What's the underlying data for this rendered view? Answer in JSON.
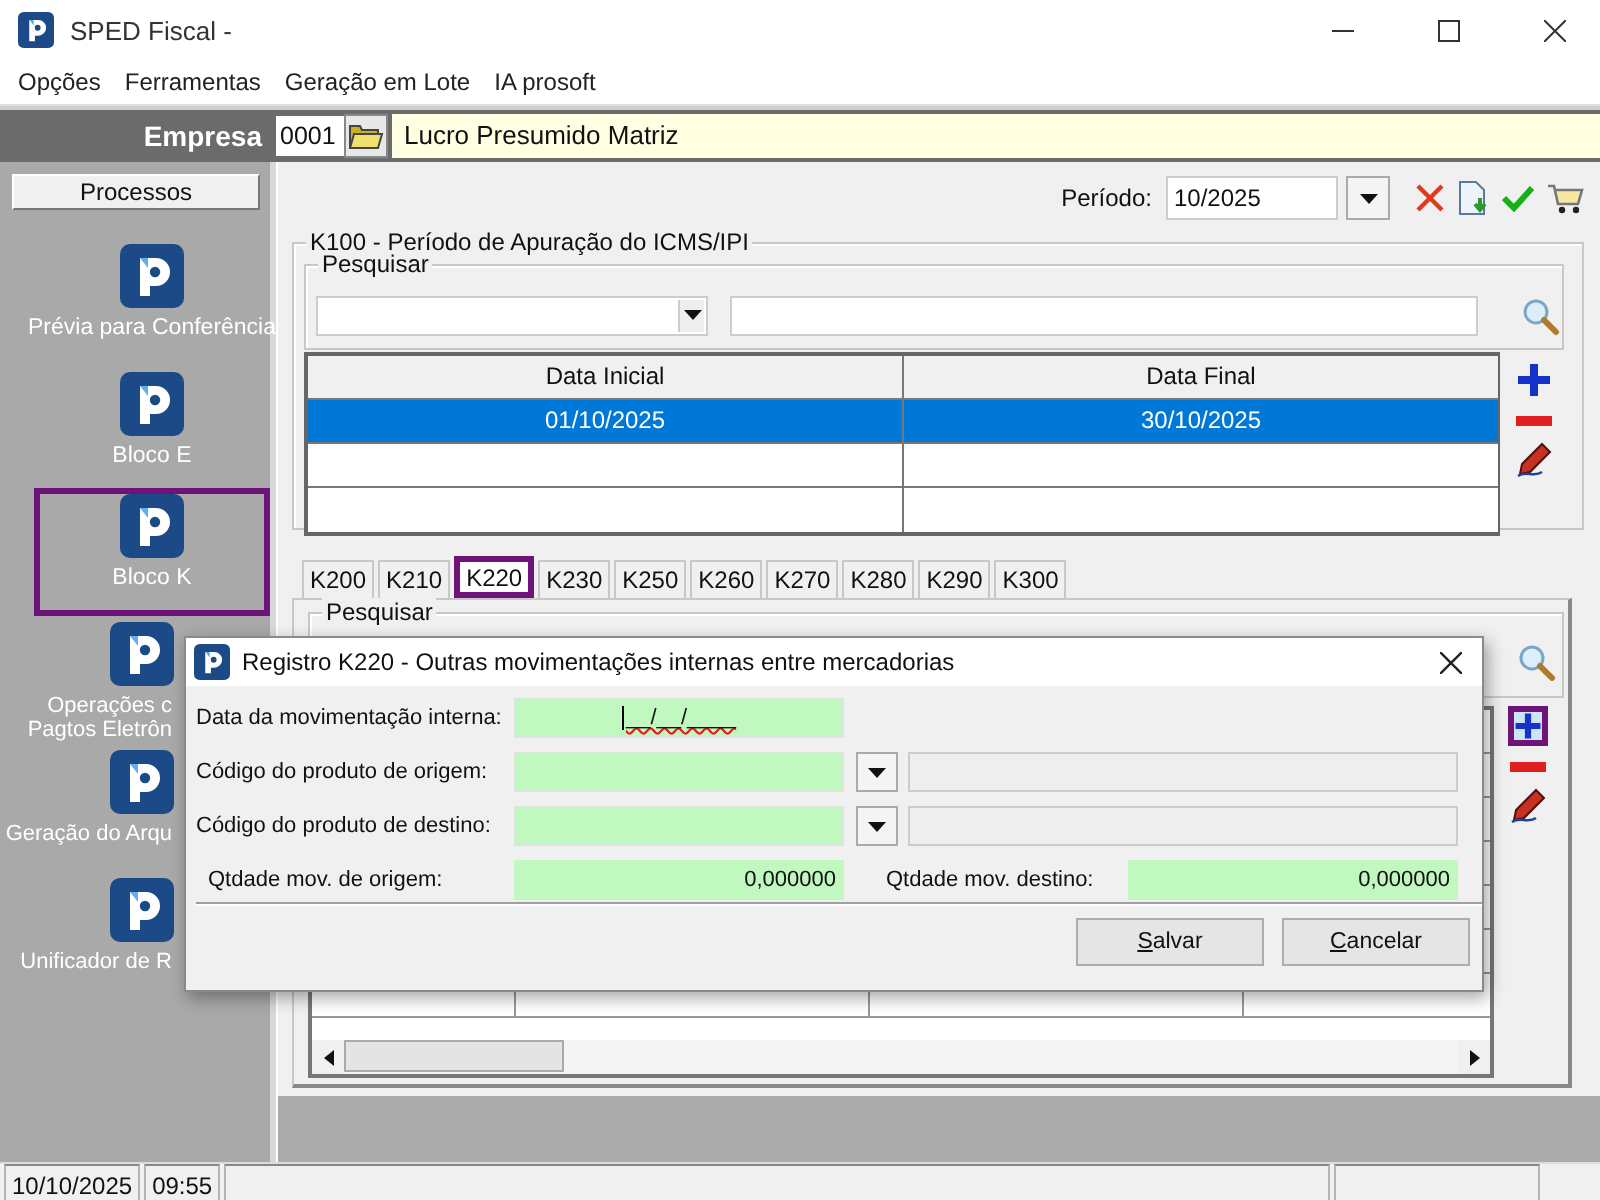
{
  "window": {
    "title": "SPED Fiscal -"
  },
  "menu": [
    "Opções",
    "Ferramentas",
    "Geração em Lote",
    "IA prosoft"
  ],
  "empresa": {
    "label": "Empresa",
    "code": "0001",
    "name": "Lucro Presumido Matriz"
  },
  "sidebar": {
    "header": "Processos",
    "items": [
      {
        "lines": [
          "Prévia para Conferência"
        ],
        "highlighted": false,
        "clipped": false
      },
      {
        "lines": [
          "Bloco E"
        ],
        "highlighted": false,
        "clipped": false
      },
      {
        "lines": [
          "Bloco K"
        ],
        "highlighted": true,
        "clipped": false
      },
      {
        "lines": [
          "Operações c",
          "Pagtos Eletrôn"
        ],
        "highlighted": false,
        "clipped": true
      },
      {
        "lines": [
          "Geração do Arqu"
        ],
        "highlighted": false,
        "clipped": true
      },
      {
        "lines": [
          "Unificador de R"
        ],
        "highlighted": false,
        "clipped": true
      }
    ]
  },
  "periodo": {
    "label": "Período:",
    "value": "10/2025"
  },
  "k100": {
    "title": "K100 - Período de Apuração do ICMS/IPI",
    "search_label": "Pesquisar",
    "columns": [
      "Data Inicial",
      "Data Final"
    ],
    "rows": [
      {
        "cells": [
          "01/10/2025",
          "30/10/2025"
        ],
        "selected": true
      }
    ]
  },
  "tabs": [
    {
      "label": "K200",
      "selected": false,
      "highlighted": false
    },
    {
      "label": "K210",
      "selected": false,
      "highlighted": false
    },
    {
      "label": "K220",
      "selected": true,
      "highlighted": true
    },
    {
      "label": "K230",
      "selected": false,
      "highlighted": false
    },
    {
      "label": "K250",
      "selected": false,
      "highlighted": false
    },
    {
      "label": "K260",
      "selected": false,
      "highlighted": false
    },
    {
      "label": "K270",
      "selected": false,
      "highlighted": false
    },
    {
      "label": "K280",
      "selected": false,
      "highlighted": false
    },
    {
      "label": "K290",
      "selected": false,
      "highlighted": false
    },
    {
      "label": "K300",
      "selected": false,
      "highlighted": false
    }
  ],
  "tab_page": {
    "search_label": "Pesquisar",
    "add_highlighted": true
  },
  "dialog": {
    "title": "Registro K220 - Outras movimentações internas entre mercadorias",
    "fields": [
      {
        "label": "Data da movimentação interna:",
        "kind": "date",
        "value": "__/__/____"
      },
      {
        "label": "Código do produto de origem:",
        "kind": "lookup"
      },
      {
        "label": "Código do produto de destino:",
        "kind": "lookup"
      }
    ],
    "quantities": [
      {
        "label": "Qtdade mov. de origem:",
        "value": "0,000000"
      },
      {
        "label": "Qtdade mov. destino:",
        "value": "0,000000"
      }
    ],
    "buttons": [
      {
        "mnemonic": "S",
        "rest": "alvar"
      },
      {
        "mnemonic": "C",
        "rest": "ancelar"
      }
    ]
  },
  "status_bar": {
    "date": "10/10/2025",
    "time": "09:55"
  }
}
